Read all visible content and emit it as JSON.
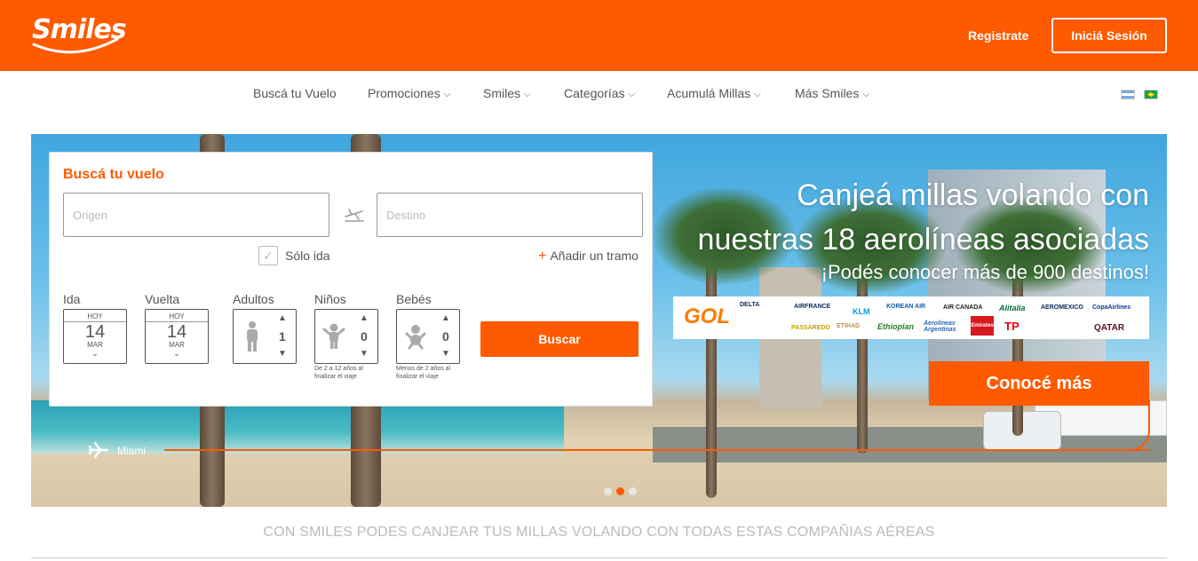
{
  "header": {
    "logo_text": "Smiles",
    "register_label": "Registrate",
    "login_label": "Iniciá Sesión"
  },
  "nav": {
    "items": [
      {
        "label": "Buscá tu Vuelo",
        "dropdown": false
      },
      {
        "label": "Promociones",
        "dropdown": true
      },
      {
        "label": "Smiles",
        "dropdown": true
      },
      {
        "label": "Categorías",
        "dropdown": true
      },
      {
        "label": "Acumulá Millas",
        "dropdown": true
      },
      {
        "label": "Más Smiles",
        "dropdown": true
      }
    ],
    "flags": [
      "argentina-flag-icon",
      "brazil-flag-icon"
    ]
  },
  "search": {
    "title": "Buscá tu vuelo",
    "origin_placeholder": "Origen",
    "destination_placeholder": "Destino",
    "one_way_label": "Sólo ida",
    "one_way_checked": false,
    "add_leg_label": "Añadir un tramo",
    "add_leg_prefix": "+",
    "ida": {
      "label": "Ida",
      "top": "HOY",
      "day": "14",
      "month": "MAR"
    },
    "vuelta": {
      "label": "Vuelta",
      "top": "HOY",
      "day": "14",
      "month": "MAR"
    },
    "adults": {
      "label": "Adultos",
      "value": "1"
    },
    "children": {
      "label": "Niños",
      "value": "0",
      "note": "De 2 a 12 años al finalizar el viaje"
    },
    "babies": {
      "label": "Bebés",
      "value": "0",
      "note": "Menos de 2 años al finalizar el viaje"
    },
    "submit_label": "Buscar"
  },
  "hero": {
    "headline_line1": "Canjeá millas volando con",
    "headline_line2": "nuestras 18 aerolíneas asociadas",
    "subheadline": "¡Podés conocer más de 900 destinos!",
    "cta_label": "Conocé más",
    "route_label": "Miami",
    "carousel_dots": 3,
    "carousel_active": 1,
    "airlines": [
      "GOL",
      "DELTA",
      "AIRFRANCE",
      "KLM",
      "KOREAN AIR",
      "AIR CANADA",
      "Alitalia",
      "AEROMEXICO",
      "CopaAirlines",
      "PASSAREDO",
      "ETIHAD",
      "Ethiopian",
      "Aerolíneas Argentinas",
      "Emirates",
      "TP",
      "QATAR"
    ]
  },
  "colors": {
    "accent": "#ff5a00",
    "text": "#555555",
    "muted": "#bbbbbb"
  },
  "footer": {
    "caption": "CON SMILES PODES CANJEAR TUS MILLAS VOLANDO CON TODAS ESTAS COMPAÑIAS AÉREAS"
  }
}
